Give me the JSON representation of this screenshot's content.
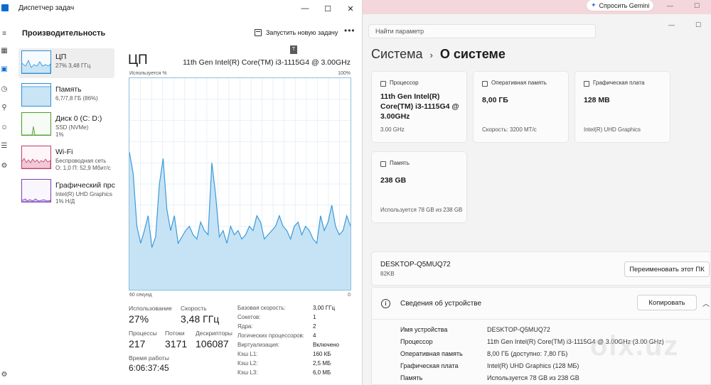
{
  "task_manager": {
    "window_title": "Диспетчер задач",
    "window_controls": {
      "minimize": "—",
      "maximize": "☐",
      "close": "✕"
    },
    "header": {
      "title": "Производительность",
      "run_task_label": "Запустить новую задачу",
      "more_label": "•••"
    },
    "rail_icons": [
      "menu-icon",
      "processes-icon",
      "performance-icon",
      "app-history-icon",
      "startup-icon",
      "users-icon",
      "details-icon",
      "services-icon",
      "settings-icon"
    ],
    "sidebar": {
      "items": [
        {
          "name": "ЦП",
          "line1": "27% 3,48 ГГц",
          "line2": "",
          "color": "#2b8fd5"
        },
        {
          "name": "Память",
          "line1": "6,7/7,8 ГБ (86%)",
          "line2": "",
          "color": "#2b8fd5"
        },
        {
          "name": "Диск 0 (C: D:)",
          "line1": "SSD (NVMe)",
          "line2": "1%",
          "color": "#4c9a2a"
        },
        {
          "name": "Wi-Fi",
          "line1": "Беспроводная сеть",
          "line2": "О: 1,0 П: 52,9 Мбит/с",
          "color": "#c23b6a"
        },
        {
          "name": "Графический прс",
          "line1": "Intel(R) UHD Graphics",
          "line2": "1% Н/Д",
          "color": "#7b3fb7"
        }
      ]
    },
    "cpu": {
      "label": "ЦП",
      "model": "11th Gen Intel(R) Core(TM) i3-1115G4 @ 3.00GHz",
      "usage_label": "Используется %",
      "usage_max": "100%",
      "graph_time": "60 секунд",
      "graph_zero": "0",
      "tooltip": "T",
      "stats": {
        "usage_label": "Использование",
        "usage_value": "27%",
        "speed_label": "Скорость",
        "speed_value": "3,48 ГГц",
        "processes_label": "Процессы",
        "processes_value": "217",
        "threads_label": "Потоки",
        "threads_value": "3171",
        "handles_label": "Дескрипторы",
        "handles_value": "106087",
        "uptime_label": "Время работы",
        "uptime_value": "6:06:37:45"
      },
      "specs": [
        {
          "k": "Базовая скорость:",
          "v": "3,00 ГГц"
        },
        {
          "k": "Сокетов:",
          "v": "1"
        },
        {
          "k": "Ядра:",
          "v": "2"
        },
        {
          "k": "Логических процессоров:",
          "v": "4"
        },
        {
          "k": "Виртуализация:",
          "v": "Включено"
        },
        {
          "k": "Кэш L1:",
          "v": "160 КБ"
        },
        {
          "k": "Кэш L2:",
          "v": "2,5 МБ"
        },
        {
          "k": "Кэш L3:",
          "v": "6,0 МБ"
        }
      ],
      "history_percent": [
        65,
        55,
        30,
        22,
        28,
        35,
        20,
        25,
        50,
        62,
        38,
        28,
        35,
        22,
        25,
        28,
        30,
        26,
        24,
        32,
        28,
        26,
        60,
        45,
        25,
        28,
        22,
        30,
        26,
        28,
        24,
        26,
        30,
        28,
        35,
        32,
        24,
        26,
        28,
        30,
        35,
        30,
        28,
        24,
        30,
        32,
        26,
        30,
        28,
        24,
        22,
        35,
        28,
        32,
        40,
        30,
        26,
        28,
        35,
        30
      ]
    }
  },
  "browser_bar": {
    "gemini_label": "Спросить Gemini",
    "controls": [
      "—",
      "☐"
    ]
  },
  "settings": {
    "search_placeholder": "Найти параметр",
    "window_controls": [
      "—",
      "☐"
    ],
    "breadcrumb_parent": "Система",
    "breadcrumb_sep": "›",
    "breadcrumb_current": "О системе",
    "cards": [
      {
        "label": "Процессор",
        "value": "11th Gen Intel(R) Core(TM) i3-1115G4 @ 3.00GHz",
        "sub": "3.00 GHz"
      },
      {
        "label": "Оперативная память",
        "value": "8,00 ГБ",
        "sub": "Скорость: 3200 МТ/с"
      },
      {
        "label": "Графическая плата",
        "value": "128 MB",
        "sub": "Intel(R) UHD Graphics"
      },
      {
        "label": "Память",
        "value": "238 GB",
        "sub": "Используется 78 GB из 238 GB"
      }
    ],
    "device_name": "DESKTOP-Q5MUQ72",
    "device_model": "82KB",
    "rename_label": "Переименовать этот ПК",
    "specs_title": "Сведения об устройстве",
    "copy_label": "Копировать",
    "spec_rows": [
      {
        "k": "Имя устройства",
        "v": "DESKTOP-Q5MUQ72"
      },
      {
        "k": "Процессор",
        "v": "11th Gen Intel(R) Core(TM) i3-1115G4 @ 3.00GHz (3.00 GHz)"
      },
      {
        "k": "Оперативная память",
        "v": "8,00 ГБ (доступно: 7,80 ГБ)"
      },
      {
        "k": "Графическая плата",
        "v": "Intel(R) UHD Graphics (128 МБ)"
      },
      {
        "k": "Память",
        "v": "Используется 78 GB из 238 GB"
      }
    ]
  },
  "watermark": "olx.uz"
}
